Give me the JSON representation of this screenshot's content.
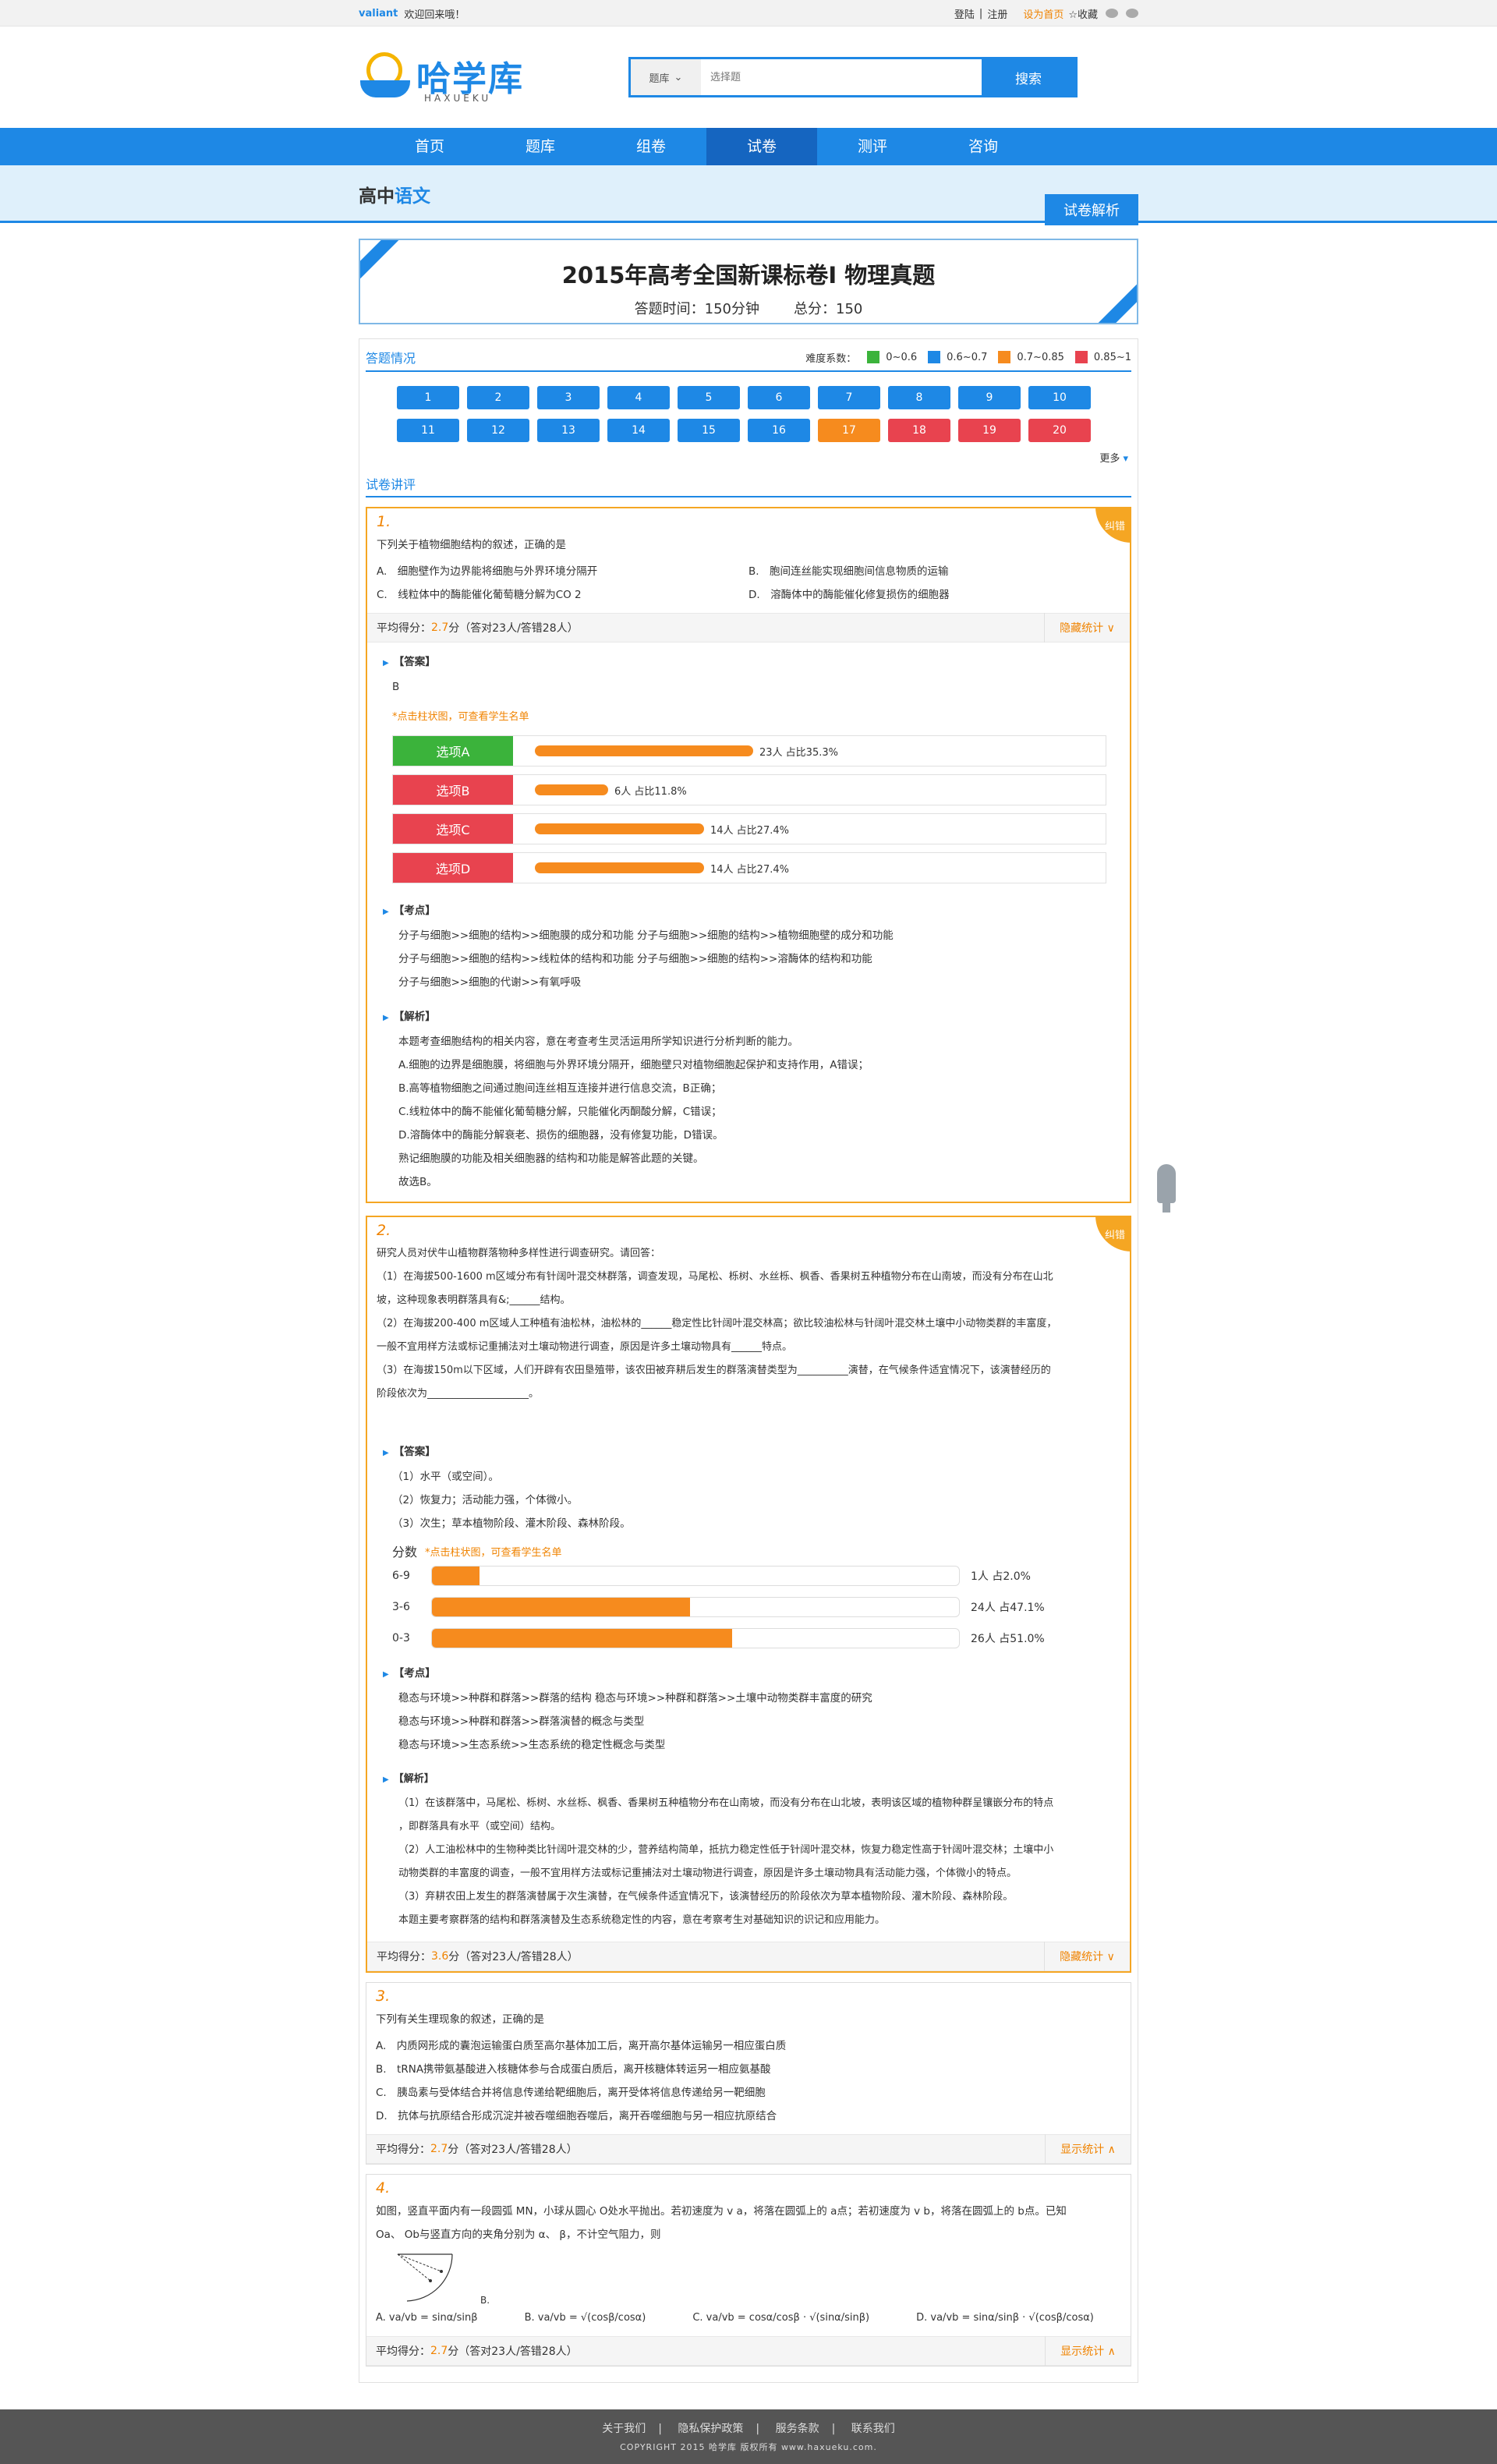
{
  "topbar": {
    "brand": "valiant",
    "welcome": "欢迎回来哦！",
    "login": "登陆",
    "sep": "|",
    "register": "注册",
    "sethome": "设为首页",
    "favorite": "☆收藏"
  },
  "logo": {
    "text": "哈学库",
    "sub": "HAXUEKU"
  },
  "search": {
    "category": "题库",
    "placeholder": "选择题",
    "button": "搜索"
  },
  "nav": [
    "首页",
    "题库",
    "组卷",
    "试卷",
    "测评",
    "咨询"
  ],
  "crumb": {
    "main": "高中",
    "sub": "语文",
    "tab": "试卷解析"
  },
  "paper": {
    "title": "2015年高考全国新课标卷Ⅰ  物理真题",
    "time": "答题时间：150分钟",
    "total": "总分：150"
  },
  "overview": {
    "label": "答题情况",
    "legend_title": "难度系数：",
    "legend": [
      {
        "color": "#3bb33b",
        "text": "0~0.6"
      },
      {
        "color": "#1e88e5",
        "text": "0.6~0.7"
      },
      {
        "color": "#f68b1e",
        "text": "0.7~0.85"
      },
      {
        "color": "#e8434f",
        "text": "0.85~1"
      }
    ],
    "numbers": [
      "1",
      "2",
      "3",
      "4",
      "5",
      "6",
      "7",
      "8",
      "9",
      "10",
      "11",
      "12",
      "13",
      "14",
      "15",
      "16",
      "17",
      "18",
      "19",
      "20"
    ],
    "more": "更多"
  },
  "lecture": {
    "label": "试卷讲评"
  },
  "q1": {
    "num": "1.",
    "err": "纠错",
    "stem": "下列关于植物细胞结构的叙述，正确的是",
    "options": [
      "A.　细胞壁作为边界能将细胞与外界环境分隔开",
      "B.　胞间连丝能实现细胞间信息物质的运输",
      "C.　线粒体中的酶能催化葡萄糖分解为CO 2",
      "D.　溶酶体中的酶能催化修复损伤的细胞器"
    ],
    "stat": "平均得分：",
    "score": "2.7",
    "stat_tail": " 分（答对23人/答错28人）",
    "toggle": "隐藏统计 ∨",
    "answer_h": "【答案】",
    "answer": "B",
    "hint": "*点击柱状图，可查看学生名单",
    "bars": [
      {
        "label": "选项A",
        "value": "23人 占比35.3%",
        "pct": 35.3,
        "color": "g"
      },
      {
        "label": "选项B",
        "value": "6人 占比11.8%",
        "pct": 11.8,
        "color": "r"
      },
      {
        "label": "选项C",
        "value": "14人 占比27.4%",
        "pct": 27.4,
        "color": "r"
      },
      {
        "label": "选项D",
        "value": "14人 占比27.4%",
        "pct": 27.4,
        "color": "r"
      }
    ],
    "points_h": "【考点】",
    "points": [
      "分子与细胞>>细胞的结构>>细胞膜的成分和功能 分子与细胞>>细胞的结构>>植物细胞壁的成分和功能",
      "分子与细胞>>细胞的结构>>线粒体的结构和功能 分子与细胞>>细胞的结构>>溶酶体的结构和功能",
      "分子与细胞>>细胞的代谢>>有氧呼吸"
    ],
    "analysis_h": "【解析】",
    "analysis": [
      "本题考查细胞结构的相关内容，意在考查考生灵活运用所学知识进行分析判断的能力。",
      "A.细胞的边界是细胞膜，将细胞与外界环境分隔开，细胞壁只对植物细胞起保护和支持作用，A错误；",
      "B.高等植物细胞之间通过胞间连丝相互连接并进行信息交流，B正确；",
      "C.线粒体中的酶不能催化葡萄糖分解，只能催化丙酮酸分解，C错误；",
      "D.溶酶体中的酶能分解衰老、损伤的细胞器，没有修复功能，D错误。",
      "熟记细胞膜的功能及相关细胞器的结构和功能是解答此题的关键。",
      "故选B。"
    ]
  },
  "q2": {
    "num": "2.",
    "err": "纠错",
    "stem": [
      "研究人员对伏牛山植物群落物种多样性进行调查研究。请回答：",
      "（1）在海拔500-1600 m区域分布有针阔叶混交林群落，调查发现，马尾松、栎树、水丝栎、枫香、香果树五种植物分布在山南坡，而没有分布在山北",
      "坡，这种现象表明群落具有&;______结构。",
      "（2）在海拔200-400 m区域人工种植有油松林，油松林的______稳定性比针阔叶混交林高；欲比较油松林与针阔叶混交林土壤中小动物类群的丰富度，",
      "一般不宜用样方法或标记重捕法对土壤动物进行调查，原因是许多土壤动物具有______特点。",
      "（3）在海拔150m以下区域，人们开辟有农田垦殖带，该农田被弃耕后发生的群落演替类型为__________演替，在气候条件适宜情况下，该演替经历的",
      "阶段依次为____________________。"
    ],
    "answer_h": "【答案】",
    "answer": [
      "（1）水平（或空间）。",
      "（2）恢复力；活动能力强，个体微小。",
      "（3）次生；草本植物阶段、灌木阶段、森林阶段。"
    ],
    "score_title": "分数",
    "hint": "*点击柱状图，可查看学生名单",
    "bars": [
      {
        "label": "6-9",
        "value": "1人 占2.0%",
        "pct": 9
      },
      {
        "label": "3-6",
        "value": "24人 占47.1%",
        "pct": 49
      },
      {
        "label": "0-3",
        "value": "26人 占51.0%",
        "pct": 57
      }
    ],
    "points_h": "【考点】",
    "points": [
      "稳态与环境>>种群和群落>>群落的结构 稳态与环境>>种群和群落>>土壤中动物类群丰富度的研究",
      "稳态与环境>>种群和群落>>群落演替的概念与类型",
      "稳态与环境>>生态系统>>生态系统的稳定性概念与类型"
    ],
    "analysis_h": "【解析】",
    "analysis": [
      "（1）在该群落中，马尾松、栎树、水丝栎、枫香、香果树五种植物分布在山南坡，而没有分布在山北坡，表明该区域的植物种群呈镶嵌分布的特点",
      "，即群落具有水平（或空间）结构。",
      "（2）人工油松林中的生物种类比针阔叶混交林的少，营养结构简单，抵抗力稳定性低于针阔叶混交林，恢复力稳定性高于针阔叶混交林；土壤中小",
      "动物类群的丰富度的调查，一般不宜用样方法或标记重捕法对土壤动物进行调查，原因是许多土壤动物具有活动能力强，个体微小的特点。",
      "（3）弃耕农田上发生的群落演替属于次生演替，在气候条件适宜情况下，该演替经历的阶段依次为草本植物阶段、灌木阶段、森林阶段。",
      "本题主要考察群落的结构和群落演替及生态系统稳定性的内容，意在考察考生对基础知识的识记和应用能力。"
    ],
    "stat": "平均得分：",
    "score": "3.6",
    "stat_tail": "分（答对23人/答错28人）",
    "toggle": "隐藏统计 ∨"
  },
  "q3": {
    "num": "3.",
    "stem": "下列有关生理现象的叙述，正确的是",
    "options": [
      "A.　内质网形成的囊泡运输蛋白质至高尔基体加工后，离开高尔基体运输另一相应蛋白质",
      "B.　tRNA携带氨基酸进入核糖体参与合成蛋白质后，离开核糖体转运另一相应氨基酸",
      "C.　胰岛素与受体结合并将信息传递给靶细胞后，离开受体将信息传递给另一靶细胞",
      "D.　抗体与抗原结合形成沉淀并被吞噬细胞吞噬后，离开吞噬细胞与另一相应抗原结合"
    ],
    "stat": "平均得分：",
    "score": "2.7",
    "stat_tail": " 分（答对23人/答错28人）",
    "toggle": "显示统计 ∧"
  },
  "q4": {
    "num": "4.",
    "stem": [
      "如图，竖直平面内有一段圆弧 MN，小球从圆心 O处水平抛出。若初速度为 v a，将落在圆弧上的 a点；若初速度为 v b，将落在圆弧上的 b点。已知",
      "Oa、 Ob与竖直方向的夹角分别为 α、 β，不计空气阻力，则"
    ],
    "fig_label": "B.",
    "options": [
      "A. va/vb = sinα/sinβ",
      "B. va/vb = √(cosβ/cosα)",
      "C. va/vb = cosα/cosβ · √(sinα/sinβ)",
      "D. va/vb = sinα/sinβ · √(cosβ/cosα)"
    ],
    "stat": "平均得分：",
    "score": "2.7",
    "stat_tail": " 分（答对23人/答错28人）",
    "toggle": "显示统计 ∧"
  },
  "footer": {
    "links": [
      "关于我们",
      "|",
      "隐私保护政策",
      "|",
      "服务条款",
      "|",
      "联系我们"
    ],
    "copy": "COPYRIGHT 2015  哈学库  版权所有  www.haxueku.com."
  }
}
